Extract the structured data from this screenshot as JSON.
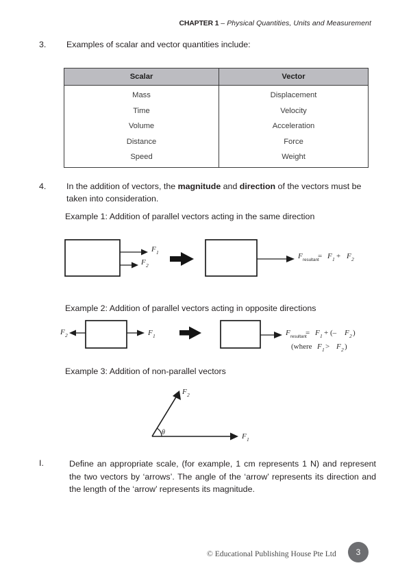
{
  "header": {
    "chapter": "CHAPTER 1",
    "dash": " – ",
    "title": "Physical Quantities, Units and Measurement"
  },
  "items": {
    "item3": {
      "number": "3.",
      "text": "Examples of scalar and vector quantities include:"
    },
    "item4": {
      "number": "4.",
      "text_part1": "In the addition of vectors, the ",
      "bold1": "magnitude",
      "text_part2": " and ",
      "bold2": "direction",
      "text_part3": " of the vectors must be taken into consideration."
    },
    "itemI": {
      "number": "I.",
      "text": "Define an appropriate scale, (for example, 1 cm represents 1 N) and represent the two vectors by ‘arrows’. The angle of the ‘arrow’ represents its direction and the length of the ‘arrow’ represents its magnitude."
    }
  },
  "table": {
    "headers": [
      "Scalar",
      "Vector"
    ],
    "rows": [
      [
        "Mass",
        "Displacement"
      ],
      [
        "Time",
        "Velocity"
      ],
      [
        "Volume",
        "Acceleration"
      ],
      [
        "Distance",
        "Force"
      ],
      [
        "Speed",
        "Weight"
      ]
    ]
  },
  "examples": {
    "ex1": {
      "caption": "Example 1: Addition of parallel vectors acting in the same direction",
      "label_f1": "F",
      "sub_f1": "1",
      "label_f2": "F",
      "sub_f2": "2",
      "result_f": "F",
      "result_sub": "resultant",
      "result_eq": " = ",
      "result_a": "F",
      "result_a_sub": "1",
      "result_plus": " + ",
      "result_b": "F",
      "result_b_sub": "2"
    },
    "ex2": {
      "caption": "Example 2: Addition of parallel vectors acting in opposite directions",
      "label_f1": "F",
      "sub_f1": "1",
      "label_f2": "F",
      "sub_f2": "2",
      "result_f": "F",
      "result_sub": "resultant",
      "result_eq": " = ",
      "result_a": "F",
      "result_a_sub": "1",
      "result_plus": " + (– ",
      "result_b": "F",
      "result_b_sub": "2",
      "result_close": ")",
      "note_open": "(where ",
      "note_a": "F",
      "note_a_sub": "1",
      "note_gt": " > ",
      "note_b": "F",
      "note_b_sub": "2",
      "note_close": ")"
    },
    "ex3": {
      "caption": "Example 3: Addition of non-parallel vectors",
      "label_f1": "F",
      "sub_f1": "1",
      "label_f2": "F",
      "sub_f2": "2",
      "theta": "θ"
    }
  },
  "footer": {
    "copyright": "© Educational Publishing House Pte Ltd",
    "page_number": "3"
  },
  "colors": {
    "table_header_fill": "#bcbcc1",
    "table_border": "#3b3b3b",
    "page_badge": "#6d6e71",
    "ink": "#231f20"
  }
}
